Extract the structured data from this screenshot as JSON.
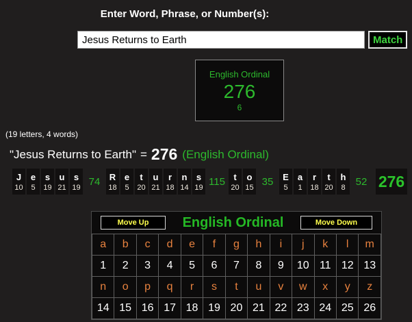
{
  "header": {
    "title": "Enter Word, Phrase, or Number(s):"
  },
  "search": {
    "value": "Jesus Returns to Earth",
    "match_label": "Match"
  },
  "result_box": {
    "cipher": "English Ordinal",
    "value": "276",
    "reduced": "6"
  },
  "summary": {
    "letters_words": "(19 letters, 4 words)",
    "phrase": "\"Jesus Returns to Earth\"",
    "equals": "=",
    "value": "276",
    "cipher": "(English Ordinal)"
  },
  "breakdown": {
    "words": [
      {
        "letters": [
          "J",
          "e",
          "s",
          "u",
          "s"
        ],
        "values": [
          "10",
          "5",
          "19",
          "21",
          "19"
        ],
        "sum": "74"
      },
      {
        "letters": [
          "R",
          "e",
          "t",
          "u",
          "r",
          "n",
          "s"
        ],
        "values": [
          "18",
          "5",
          "20",
          "21",
          "18",
          "14",
          "19"
        ],
        "sum": "115"
      },
      {
        "letters": [
          "t",
          "o"
        ],
        "values": [
          "20",
          "15"
        ],
        "sum": "35"
      },
      {
        "letters": [
          "E",
          "a",
          "r",
          "t",
          "h"
        ],
        "values": [
          "5",
          "1",
          "18",
          "20",
          "8"
        ],
        "sum": "52"
      }
    ],
    "total": "276"
  },
  "cipher_table": {
    "move_up_label": "Move Up",
    "title": "English Ordinal",
    "move_down_label": "Move Down",
    "rows": [
      {
        "letters": [
          "a",
          "b",
          "c",
          "d",
          "e",
          "f",
          "g",
          "h",
          "i",
          "j",
          "k",
          "l",
          "m"
        ],
        "values": [
          "1",
          "2",
          "3",
          "4",
          "5",
          "6",
          "7",
          "8",
          "9",
          "10",
          "11",
          "12",
          "13"
        ]
      },
      {
        "letters": [
          "n",
          "o",
          "p",
          "q",
          "r",
          "s",
          "t",
          "u",
          "v",
          "w",
          "x",
          "y",
          "z"
        ],
        "values": [
          "14",
          "15",
          "16",
          "17",
          "18",
          "19",
          "20",
          "21",
          "22",
          "23",
          "24",
          "25",
          "26"
        ]
      }
    ]
  },
  "colors": {
    "green": "#2db92d",
    "match_green": "#3fd23f",
    "orange": "#e8823f",
    "yellow": "#ffff4d",
    "page_bg": "#201e1e",
    "cell_bg": "#121010"
  }
}
